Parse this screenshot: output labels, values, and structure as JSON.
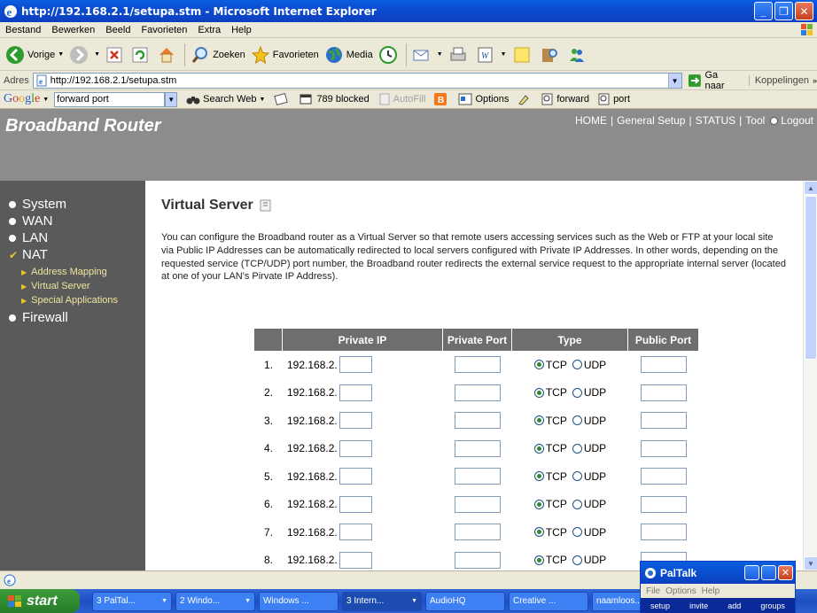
{
  "window": {
    "title": "http://192.168.2.1/setupa.stm - Microsoft Internet Explorer"
  },
  "menubar": {
    "items": [
      "Bestand",
      "Bewerken",
      "Beeld",
      "Favorieten",
      "Extra",
      "Help"
    ]
  },
  "toolbar": {
    "back_label": "Vorige",
    "search_label": "Zoeken",
    "favorites_label": "Favorieten",
    "media_label": "Media"
  },
  "address": {
    "label": "Adres",
    "url": "http://192.168.2.1/setupa.stm",
    "go_label": "Ga naar",
    "links_label": "Koppelingen"
  },
  "googlebar": {
    "query": "forward port",
    "search_web_label": "Search Web",
    "blocked_label": "789 blocked",
    "autofill_label": "AutoFill",
    "options_label": "Options",
    "term1": "forward",
    "term2": "port"
  },
  "router": {
    "brand": "Broadband Router",
    "top_links": [
      "HOME",
      "General Setup",
      "STATUS",
      "Tool"
    ],
    "logout_label": "Logout"
  },
  "sidebar": {
    "items": [
      "System",
      "WAN",
      "LAN",
      "NAT",
      "Firewall"
    ],
    "nat_sub": [
      "Address Mapping",
      "Virtual Server",
      "Special Applications"
    ]
  },
  "content": {
    "title": "Virtual Server",
    "description": "You can configure the Broadband router as a Virtual Server so that remote users accessing services such as the Web or FTP at your local site via Public IP Addresses can be automatically redirected to local servers configured with Private IP Addresses. In other words, depending on the requested service (TCP/UDP) port number, the Broadband router redirects the external service request to the appropriate internal server (located at one of your LAN's Pirvate IP Address).",
    "table_headers": [
      "Private IP",
      "Private Port",
      "Type",
      "Public Port"
    ],
    "ip_prefix": "192.168.2.",
    "tcp_label": "TCP",
    "udp_label": "UDP",
    "rows": [
      "1.",
      "2.",
      "3.",
      "4.",
      "5.",
      "6.",
      "7.",
      "8."
    ]
  },
  "taskbar": {
    "start_label": "start",
    "tasks": [
      "3 PalTal...",
      "2 Windo...",
      "Windows ...",
      "3 Intern...",
      "AudioHQ",
      "Creative ...",
      "naamloos..."
    ]
  },
  "paltalk": {
    "title": "PalTalk",
    "menu": [
      "File",
      "Options",
      "Help"
    ],
    "bar": [
      "setup",
      "invite",
      "add",
      "groups"
    ]
  }
}
